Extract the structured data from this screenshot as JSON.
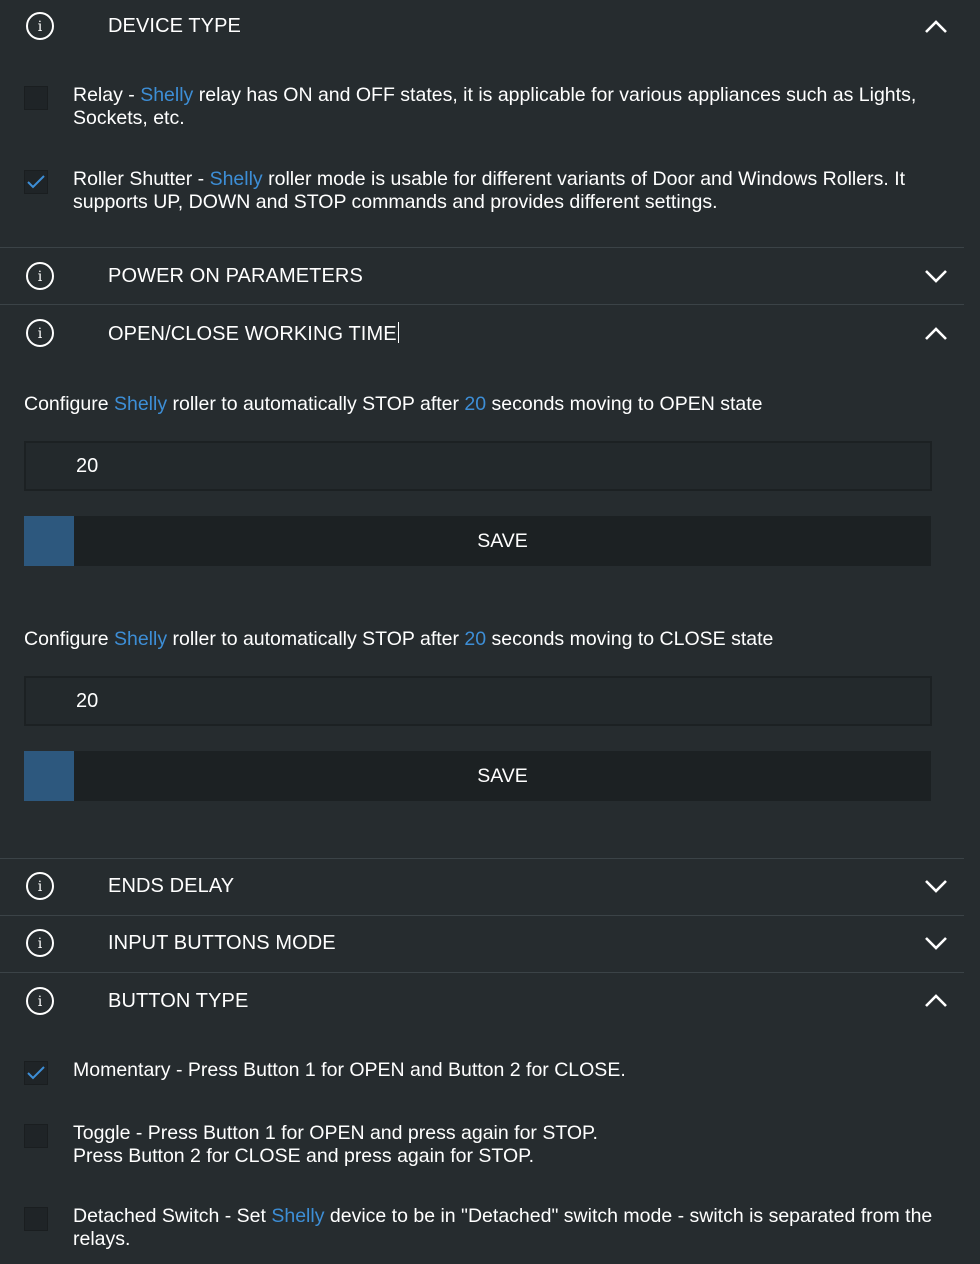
{
  "sections": {
    "device_type": {
      "title": "DEVICE TYPE",
      "expanded": true
    },
    "power_on": {
      "title": "POWER ON PARAMETERS",
      "expanded": false
    },
    "open_close": {
      "title": "OPEN/CLOSE WORKING TIME",
      "expanded": true
    },
    "ends_delay": {
      "title": "ENDS DELAY",
      "expanded": false
    },
    "input_buttons": {
      "title": "INPUT BUTTONS MODE",
      "expanded": false
    },
    "button_type": {
      "title": "BUTTON TYPE",
      "expanded": true
    }
  },
  "device_type_options": {
    "relay": {
      "checked": false,
      "label": "Relay - ",
      "brand": "Shelly",
      "text": " relay has ON and OFF states, it is applicable for various appliances such as Lights, Sockets, etc."
    },
    "roller": {
      "checked": true,
      "label": "Roller Shutter - ",
      "brand": "Shelly",
      "text": " roller mode is usable for different variants of Door and Windows Rollers. It supports UP, DOWN and STOP commands and provides different settings."
    }
  },
  "open_time": {
    "desc_prefix": "Configure ",
    "brand": "Shelly",
    "desc_mid": " roller to automatically STOP after ",
    "seconds": "20",
    "desc_suffix": " seconds moving to OPEN state",
    "input_value": "20",
    "save_label": "SAVE"
  },
  "close_time": {
    "desc_prefix": "Configure ",
    "brand": "Shelly",
    "desc_mid": " roller to automatically STOP after ",
    "seconds": "20",
    "desc_suffix": " seconds moving to CLOSE state",
    "input_value": "20",
    "save_label": "SAVE"
  },
  "button_type_options": {
    "momentary": {
      "checked": true,
      "text": "Momentary - Press Button 1 for OPEN and Button 2 for CLOSE."
    },
    "toggle": {
      "checked": false,
      "line1": "Toggle - Press Button 1 for OPEN and press again for STOP.",
      "line2": "Press Button 2 for CLOSE and press again for STOP."
    },
    "detached": {
      "checked": false,
      "label": "Detached Switch - Set ",
      "brand": "Shelly",
      "text": " device to be in \"Detached\" switch mode - switch is separated from the relays."
    }
  },
  "colors": {
    "background": "#262c2f",
    "accent_blue": "#3d8ed6",
    "save_accent": "#2d587e",
    "input_bg": "#23292c",
    "divider": "#3b4347"
  },
  "icons": {
    "info": "info-circle-icon",
    "chevron_up": "chevron-up-icon",
    "chevron_down": "chevron-down-icon",
    "check": "check-icon"
  }
}
